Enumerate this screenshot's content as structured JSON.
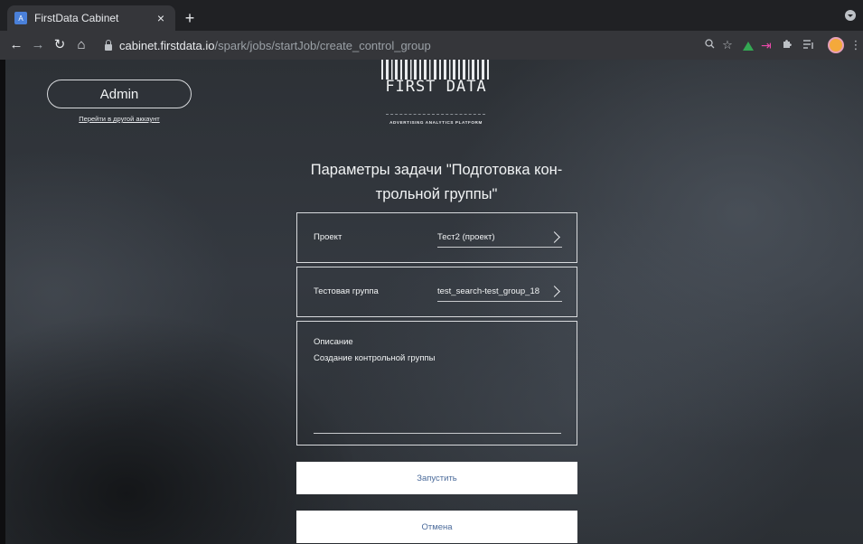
{
  "browser": {
    "tab_title": "FirstData Cabinet",
    "tab_favicon_letter": "A",
    "tab_close": "×",
    "new_tab": "+",
    "url_host": "cabinet.firstdata.io",
    "url_path": "/spark/jobs/startJob/create_control_group",
    "icons": [
      "back-icon",
      "forward-icon",
      "reload-icon",
      "home-icon",
      "lock-icon",
      "zoom-icon",
      "bookmark-star-icon",
      "google-drive-icon",
      "extension-arrow-icon",
      "puzzle-icon",
      "reading-list-icon",
      "profile-avatar-icon",
      "kebab-menu-icon"
    ]
  },
  "header": {
    "account_name": "Admin",
    "switch_account_link": "Перейти в другой аккаунт",
    "logo_text": "FIRST DATA",
    "logo_subtitle": "ADVERTISING ANALYTICS PLATFORM"
  },
  "form": {
    "title_line1": "Параметры задачи \"Подготовка кон-",
    "title_line2": "трольной группы\"",
    "project": {
      "label": "Проект",
      "value": "Тест2 (проект)"
    },
    "test_group": {
      "label": "Тестовая группа",
      "value": "test_search-test_group_18"
    },
    "description": {
      "label": "Описание",
      "value": "Создание контрольной группы"
    },
    "run_button": "Запустить",
    "cancel_button": "Отмена"
  }
}
